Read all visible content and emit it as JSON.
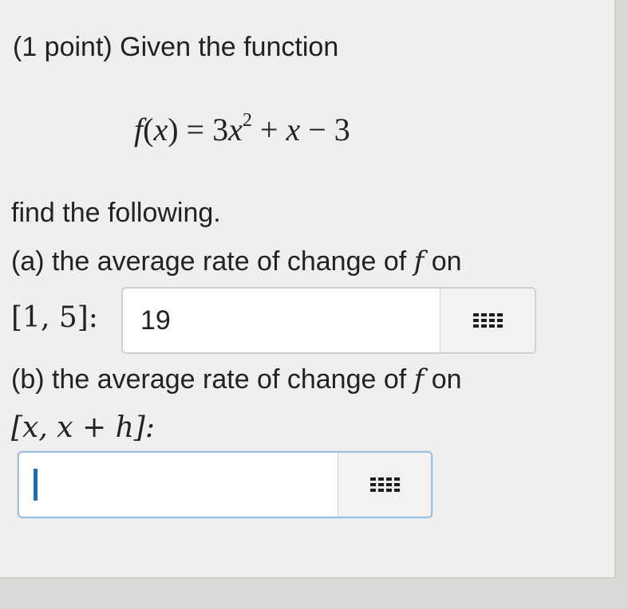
{
  "problem": {
    "intro": "(1 point) Given the function",
    "formula": "f(x) = 3x² + x − 3",
    "instruction": "find the following."
  },
  "part_a": {
    "prompt_start": "(a) the average rate of change of",
    "prompt_var": "f",
    "prompt_end": "on",
    "interval": "[1, 5]:",
    "answer_value": "19"
  },
  "part_b": {
    "prompt_start": "(b) the average rate of change of",
    "prompt_var": "f",
    "prompt_end": "on",
    "interval": "[x, x + h]:",
    "answer_value": ""
  },
  "icons": {
    "palette": "equation-palette-grid-icon"
  }
}
